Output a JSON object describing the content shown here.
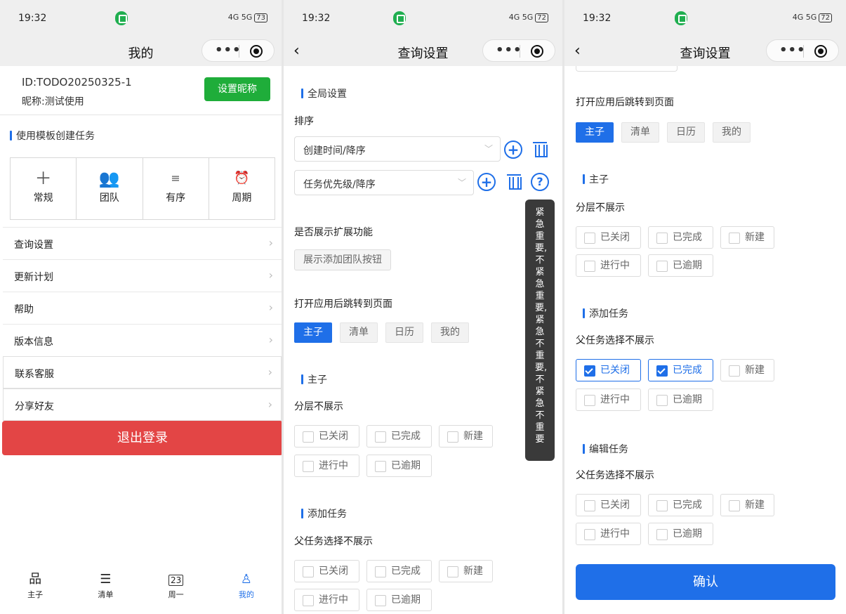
{
  "status": {
    "p1": {
      "time": "19:32",
      "battery": "73"
    },
    "p2": {
      "time": "19:32",
      "battery": "72"
    },
    "p3": {
      "time": "19:32",
      "battery": "72"
    },
    "signal": "4G 5G"
  },
  "p1": {
    "title": "我的",
    "user_id": "ID:TODO20250325-1",
    "nickname": "昵称:测试使用",
    "set_nickname": "设置昵称",
    "template_heading": "使用模板创建任务",
    "templates": [
      {
        "label": "常规",
        "icon": "plus-icon"
      },
      {
        "label": "团队",
        "icon": "team-icon"
      },
      {
        "label": "有序",
        "icon": "ordered-list-icon"
      },
      {
        "label": "周期",
        "icon": "alarm-clock-icon"
      }
    ],
    "menu": [
      "查询设置",
      "更新计划",
      "帮助",
      "版本信息",
      "联系客服",
      "分享好友"
    ],
    "logout": "退出登录",
    "tabs": [
      {
        "label": "主子",
        "icon": "hierarchy-icon"
      },
      {
        "label": "清单",
        "icon": "checklist-icon"
      },
      {
        "label": "周一",
        "icon": "calendar-icon",
        "day": "23"
      },
      {
        "label": "我的",
        "icon": "person-icon"
      }
    ]
  },
  "p2": {
    "title": "查询设置",
    "global_heading": "全局设置",
    "sort_label": "排序",
    "sort1": "创建时间/降序",
    "sort2": "任务优先级/降序",
    "expand_label": "是否展示扩展功能",
    "expand_btn": "展示添加团队按钮",
    "jump_label": "打开应用后跳转到页面",
    "pages": [
      "主子",
      "清单",
      "日历",
      "我的"
    ],
    "tooltip": "紧急重要,不紧急重要,紧急不重要,不紧急不重要",
    "section_master": "主子",
    "hide_layer": "分层不展示",
    "section_add": "添加任务",
    "parent_hide": "父任务选择不展示",
    "statuses": [
      "已关闭",
      "已完成",
      "新建",
      "进行中",
      "已逾期"
    ]
  },
  "p3": {
    "title": "查询设置",
    "jump_label": "打开应用后跳转到页面",
    "pages": [
      "主子",
      "清单",
      "日历",
      "我的"
    ],
    "section_master": "主子",
    "hide_layer": "分层不展示",
    "section_add": "添加任务",
    "parent_hide": "父任务选择不展示",
    "section_edit": "编辑任务",
    "parent_hide_edit": "父任务选择不展示",
    "statuses": [
      "已关闭",
      "已完成",
      "新建",
      "进行中",
      "已逾期"
    ],
    "confirm": "确认"
  },
  "colors": {
    "accent": "#1f6fe8",
    "green": "#1fad3a",
    "danger": "#e34545"
  }
}
